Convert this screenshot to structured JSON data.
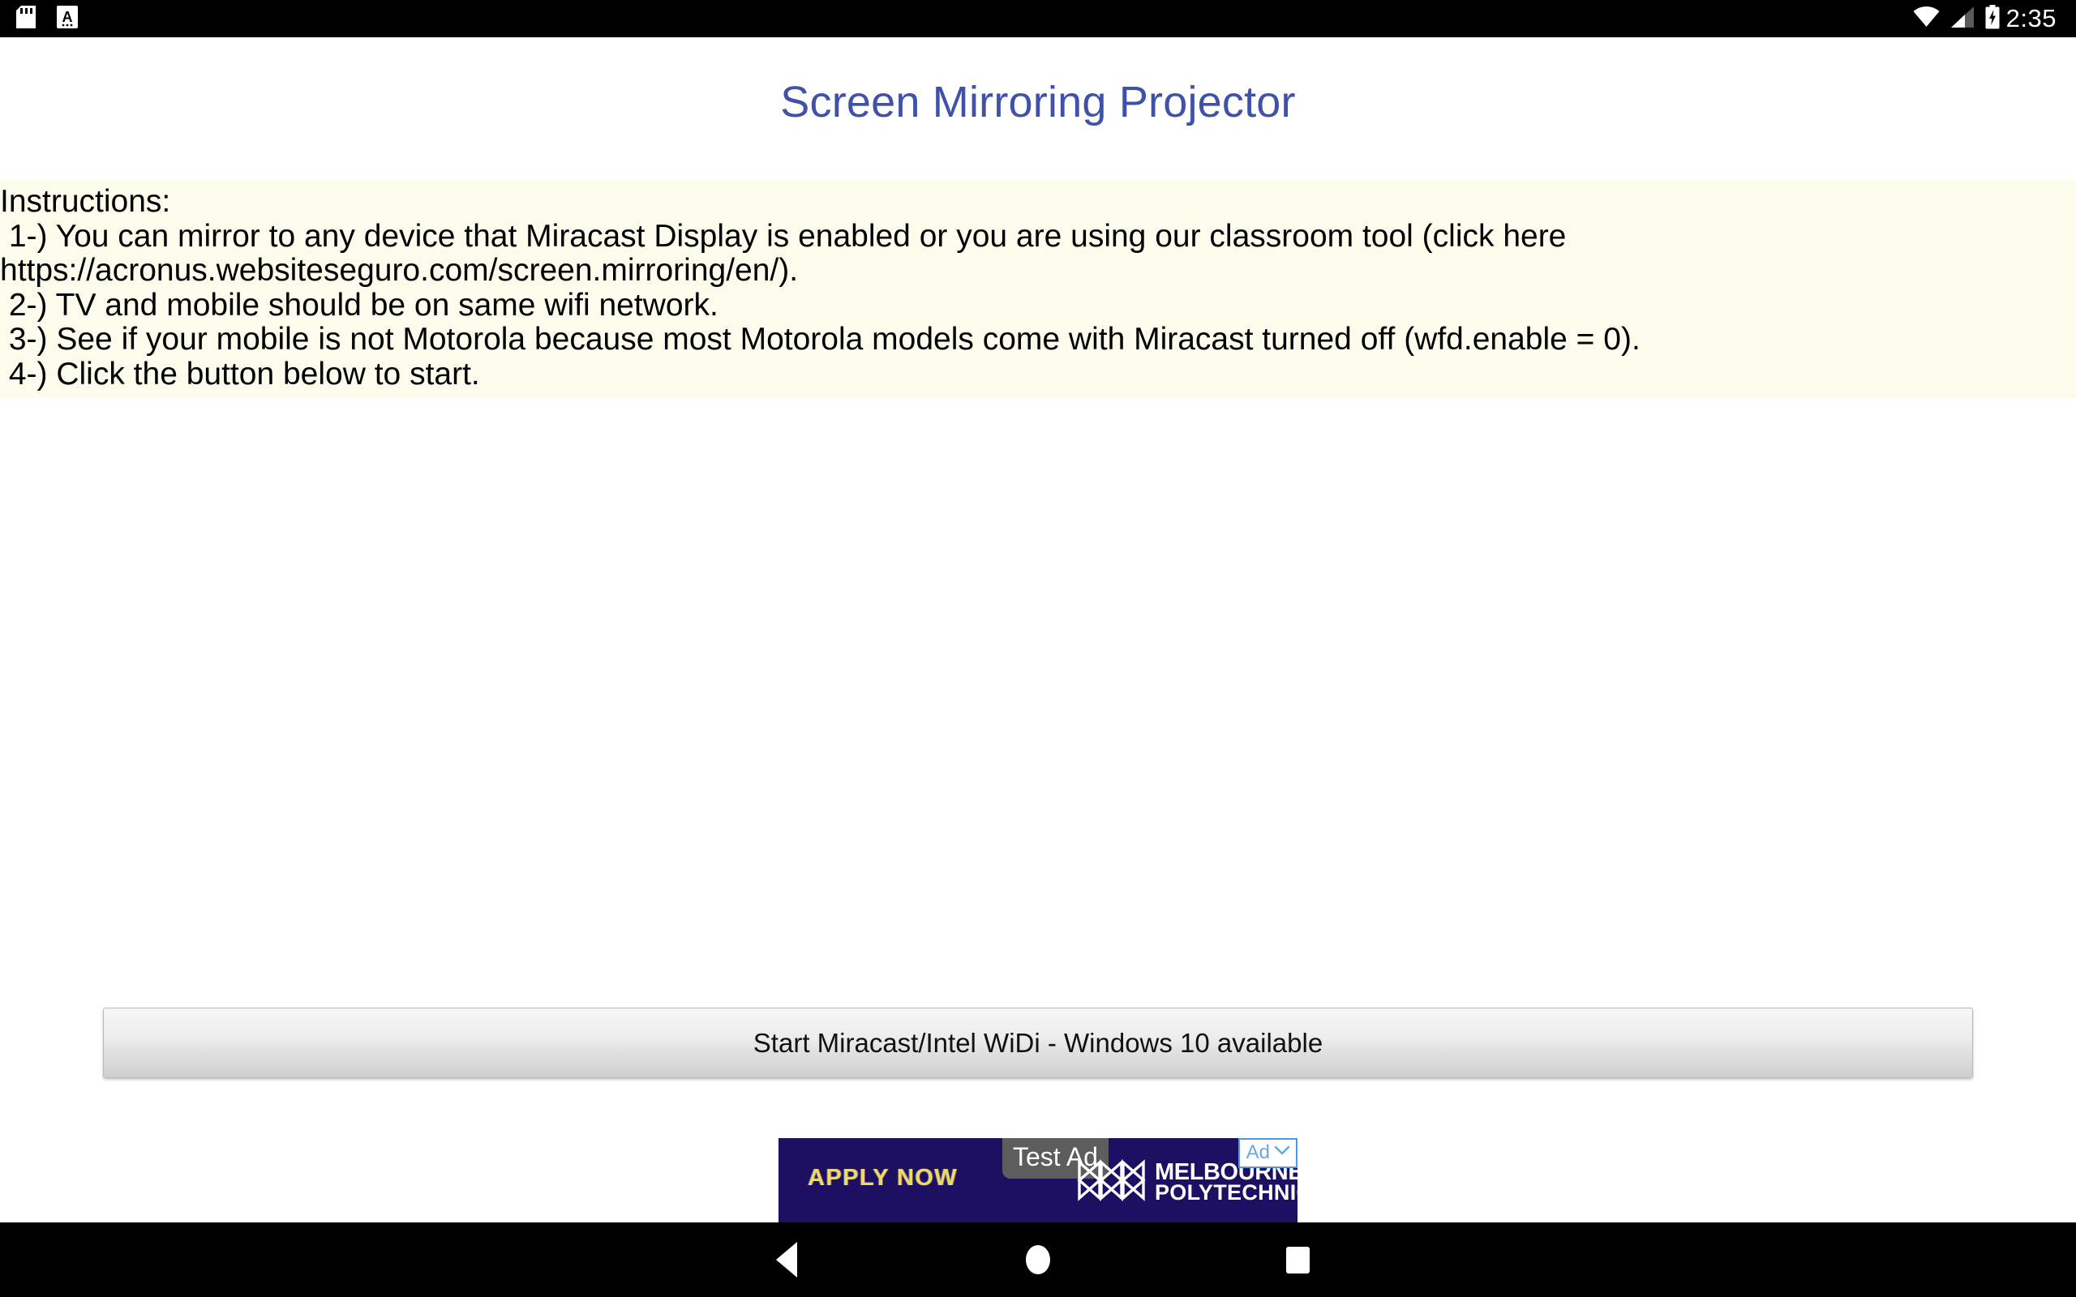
{
  "status_bar": {
    "icons_left": [
      "sd-card-icon",
      "a-font-icon"
    ],
    "icons_right": [
      "wifi-icon",
      "cell-signal-icon",
      "battery-charging-icon"
    ],
    "clock": "2:35"
  },
  "header": {
    "title": "Screen Mirroring Projector",
    "title_color": "#3f51a8"
  },
  "instructions": {
    "background_color": "#fdfbec",
    "heading": "Instructions:",
    "lines": [
      " 1-) You can mirror to any device that Miracast Display is enabled or you are using our classroom tool (click here",
      "https://acronus.websiteseguro.com/screen.mirroring/en/).",
      " 2-) TV and mobile should be on same wifi network.",
      " 3-) See if your mobile is not Motorola because most Motorola models come with Miracast turned off (wfd.enable = 0).",
      " 4-) Click the button below to start."
    ]
  },
  "main": {
    "start_button_label": "Start Miracast/Intel WiDi - Windows 10 available"
  },
  "ad": {
    "background_color": "#1d1063",
    "cta": "APPLY NOW",
    "test_label": "Test Ad",
    "advertiser_line1": "MELBOURNE",
    "advertiser_line2": "POLYTECHNIC",
    "choices_label": "Ad",
    "choices_icon": "chevron-down-icon",
    "logo_icon": "melbourne-polytechnic-logo-icon"
  },
  "navigation_bar": {
    "back": "back-icon",
    "home": "home-icon",
    "recents": "recents-icon"
  }
}
